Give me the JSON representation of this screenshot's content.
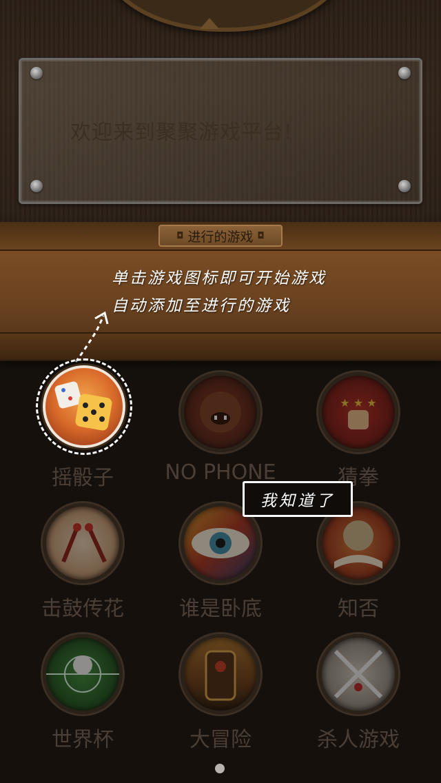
{
  "welcome_panel": {
    "text": "欢迎来到聚聚游戏平台!"
  },
  "shelf": {
    "label": "进行的游戏"
  },
  "hint": {
    "line1": "单击游戏图标即可开始游戏",
    "line2": "自动添加至进行的游戏"
  },
  "got_it_button": {
    "label": "我知道了"
  },
  "games": [
    {
      "label": "摇骰子",
      "icon": "dice-icon"
    },
    {
      "label": "NO PHONE",
      "icon": "gorilla-icon"
    },
    {
      "label": "猜拳",
      "icon": "fist-icon"
    },
    {
      "label": "击鼓传花",
      "icon": "drum-icon"
    },
    {
      "label": "谁是卧底",
      "icon": "eye-icon"
    },
    {
      "label": "知否",
      "icon": "globe-book-icon"
    },
    {
      "label": "世界杯",
      "icon": "soccer-ball-icon"
    },
    {
      "label": "大冒险",
      "icon": "door-icon"
    },
    {
      "label": "杀人游戏",
      "icon": "crossed-knives-icon"
    }
  ],
  "page_indicator": {
    "pages": 1,
    "current": 1
  },
  "colors": {
    "overlay_text": "#ffffff",
    "wood": "#6a4220",
    "icon_dice_bg": "#d86a2a"
  }
}
